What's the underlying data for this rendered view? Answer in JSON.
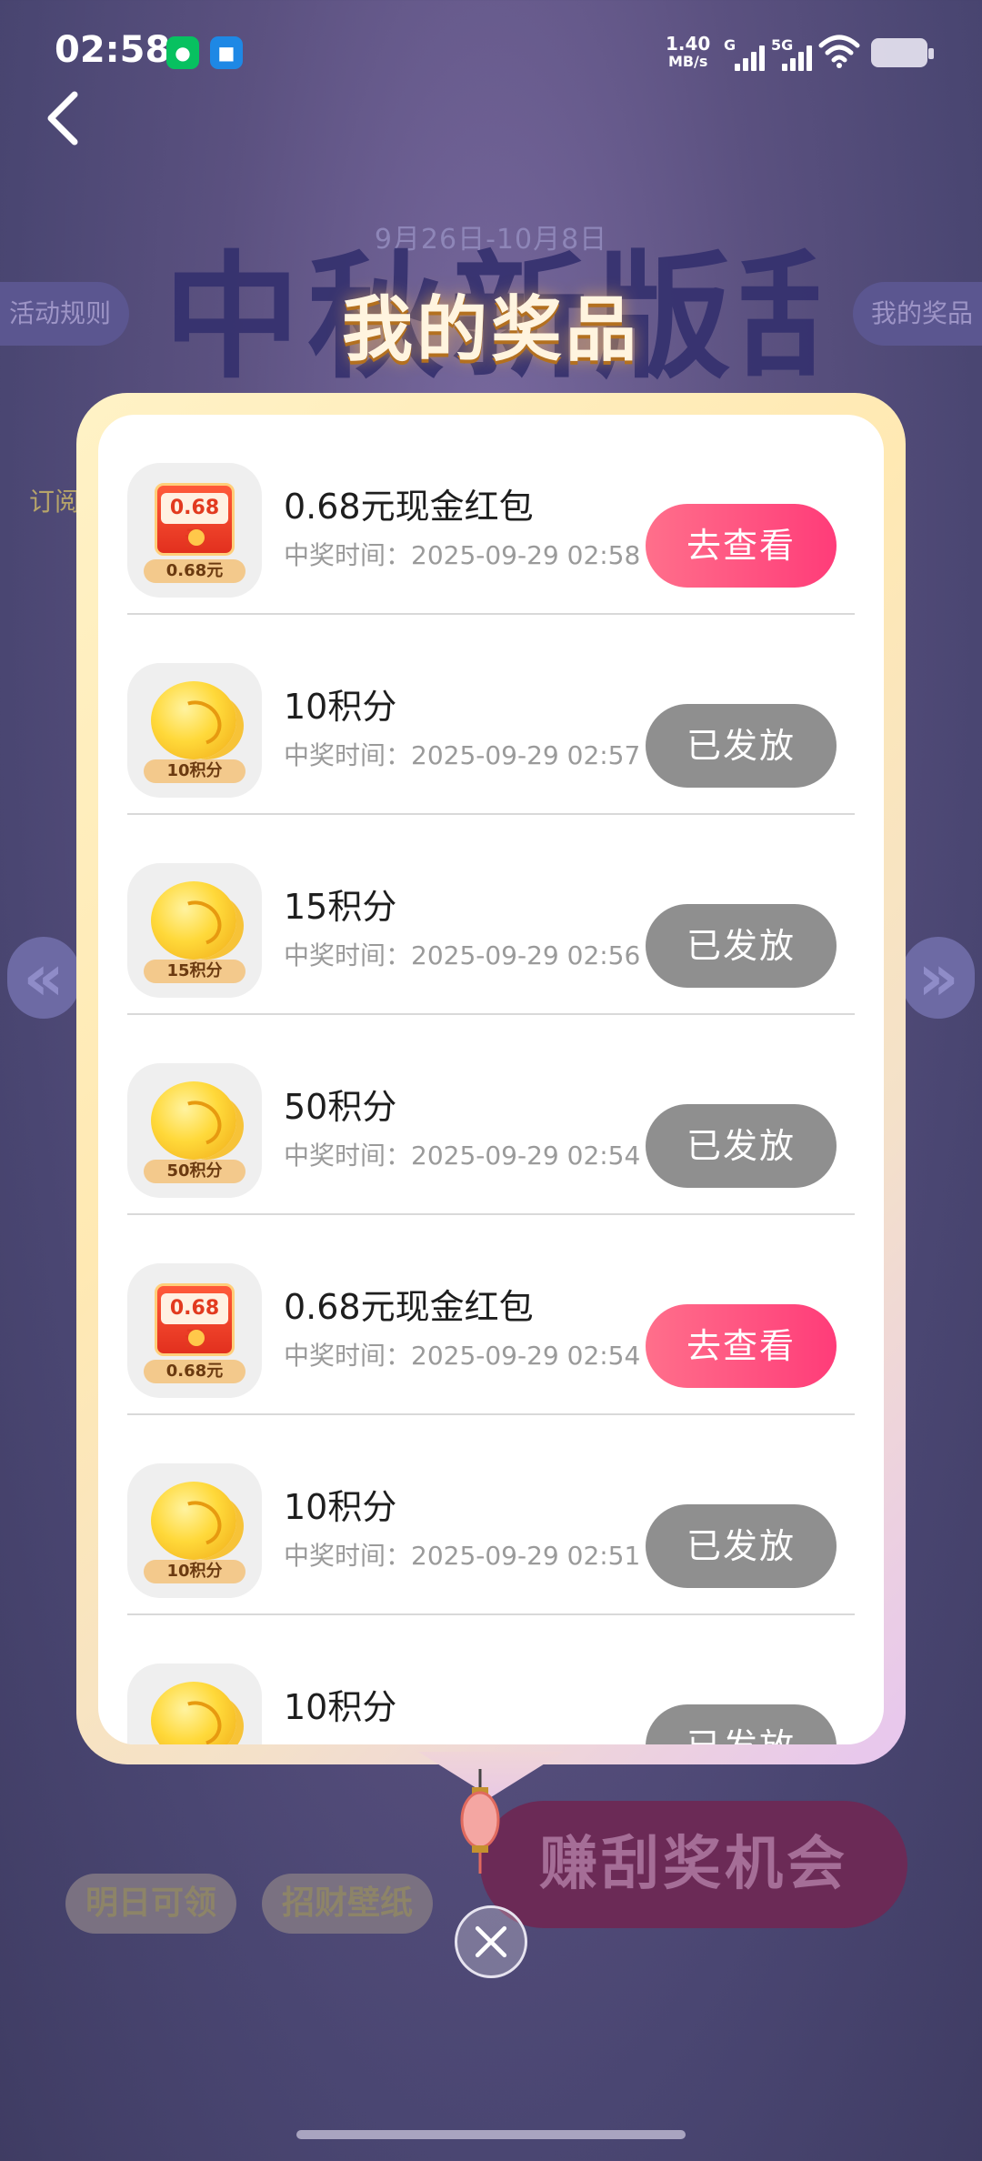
{
  "status_bar": {
    "time": "02:58",
    "net_speed_value": "1.40",
    "net_speed_unit": "MB/s",
    "signal_1": "G",
    "signal_2": "5G"
  },
  "background": {
    "date_range": "9月26日-10月8日",
    "event_title": "中秋新版刮乐",
    "rules_label": "活动规则",
    "my_prizes_label": "我的奖品",
    "subscribe_label": "订阅",
    "bottom_pills": [
      "明日可领",
      "招财壁纸"
    ],
    "earn_button": "赚刮奖机会"
  },
  "modal": {
    "title": "我的奖品",
    "prizes": [
      {
        "name": "0.68元现金红包",
        "time": "中奖时间：2025-09-29 02:58",
        "button": "去查看",
        "type": "redpacket",
        "badge": "0.68元",
        "thumb_amount": "0.68元"
      },
      {
        "name": "10积分",
        "time": "中奖时间：2025-09-29 02:57",
        "button": "已发放",
        "type": "coin",
        "badge": "10积分"
      },
      {
        "name": "15积分",
        "time": "中奖时间：2025-09-29 02:56",
        "button": "已发放",
        "type": "coin",
        "badge": "15积分"
      },
      {
        "name": "50积分",
        "time": "中奖时间：2025-09-29 02:54",
        "button": "已发放",
        "type": "coin",
        "badge": "50积分"
      },
      {
        "name": "0.68元现金红包",
        "time": "中奖时间：2025-09-29 02:54",
        "button": "去查看",
        "type": "redpacket",
        "badge": "0.68元",
        "thumb_amount": "0.68元"
      },
      {
        "name": "10积分",
        "time": "中奖时间：2025-09-29 02:51",
        "button": "已发放",
        "type": "coin",
        "badge": "10积分"
      },
      {
        "name": "10积分",
        "time": "",
        "button": "已发放",
        "type": "coin",
        "badge": ""
      }
    ]
  },
  "colors": {
    "view_button": "#ff3c79",
    "issued_button": "#8f8f8f",
    "frame_gold": "#ffe9b3"
  }
}
